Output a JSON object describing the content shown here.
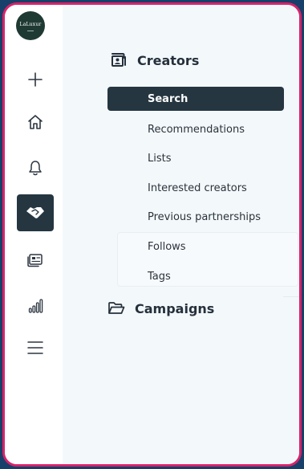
{
  "app": {
    "logo_text": "LaLuxur"
  },
  "rail": {
    "items": [
      {
        "icon": "plus-icon"
      },
      {
        "icon": "home-icon"
      },
      {
        "icon": "bell-icon"
      },
      {
        "icon": "handshake-icon",
        "active": true
      },
      {
        "icon": "id-card-icon"
      },
      {
        "icon": "bar-chart-icon"
      },
      {
        "icon": "menu-icon"
      }
    ]
  },
  "nav": {
    "creators": {
      "label": "Creators",
      "icon": "creator-id-icon",
      "items": [
        {
          "label": "Search",
          "active": true
        },
        {
          "label": "Recommendations"
        },
        {
          "label": "Lists"
        },
        {
          "label": "Interested creators"
        },
        {
          "label": "Previous partnerships"
        },
        {
          "label": "Follows"
        },
        {
          "label": "Tags"
        }
      ]
    },
    "campaigns": {
      "label": "Campaigns",
      "icon": "folder-icon"
    }
  },
  "colors": {
    "frame_border": "#d8236a",
    "background": "#17406a",
    "active": "#253641"
  }
}
